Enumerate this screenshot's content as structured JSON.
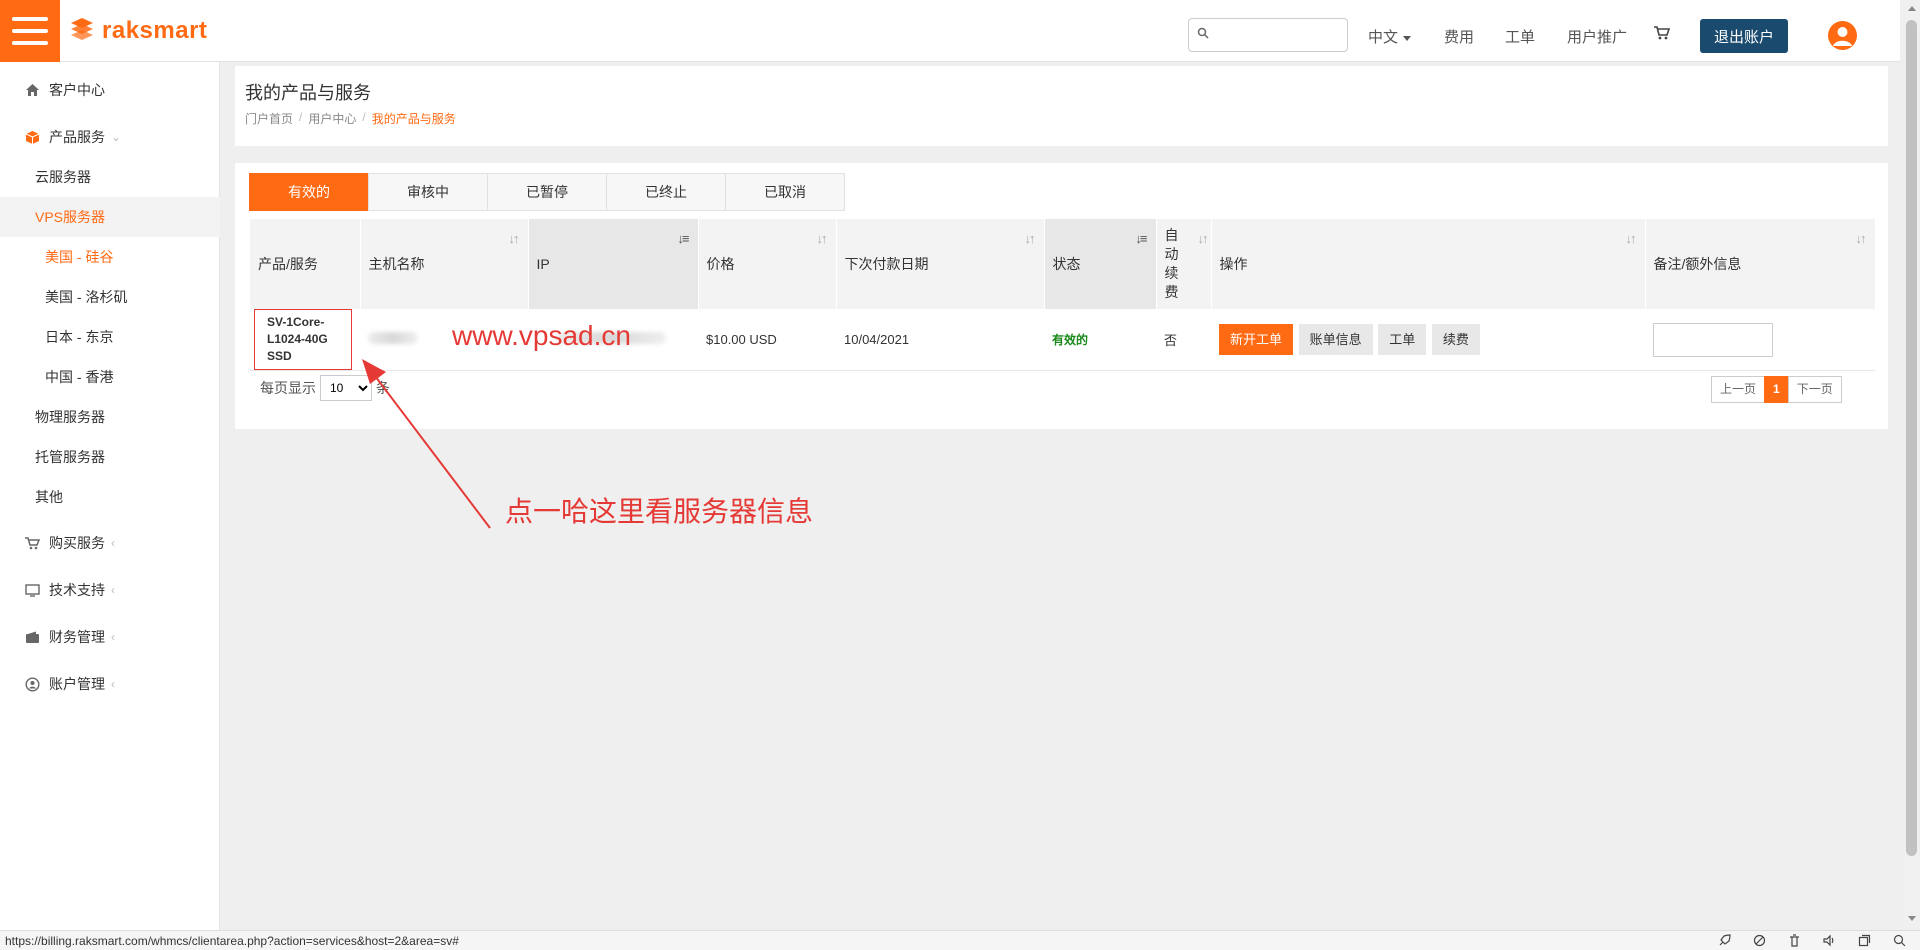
{
  "header": {
    "logo": "raksmart",
    "search_placeholder": "",
    "lang": "中文",
    "nav_fees": "费用",
    "nav_tickets": "工单",
    "nav_affiliate": "用户推广",
    "logout": "退出账户"
  },
  "sidebar": {
    "client_center": "客户中心",
    "products": "产品服务",
    "cloud": "云服务器",
    "vps": "VPS服务器",
    "vps_sub": [
      "美国 - 硅谷",
      "美国 - 洛杉矶",
      "日本 - 东京",
      "中国 - 香港"
    ],
    "physical": "物理服务器",
    "hosting": "托管服务器",
    "other": "其他",
    "buy": "购买服务",
    "support": "技术支持",
    "finance": "财务管理",
    "account": "账户管理"
  },
  "page": {
    "title": "我的产品与服务",
    "breadcrumb": [
      "门户首页",
      "用户中心",
      "我的产品与服务"
    ]
  },
  "tabs": [
    "有效的",
    "审核中",
    "已暂停",
    "已终止",
    "已取消"
  ],
  "table": {
    "headers": {
      "product": "产品/服务",
      "host": "主机名称",
      "ip": "IP",
      "price": "价格",
      "next_due": "下次付款日期",
      "status": "状态",
      "auto_renew": "自动续费",
      "actions": "操作",
      "remark": "备注/额外信息"
    },
    "rows": [
      {
        "product_line1": "SV-1Core-",
        "product_line2": "L1024-40G SSD",
        "price": "$10.00 USD",
        "next_due": "10/04/2021",
        "status": "有效的",
        "auto_renew": "否",
        "btn_new_ticket": "新开工单",
        "btn_billing": "账单信息",
        "btn_ticket": "工单",
        "btn_renew": "续费"
      }
    ]
  },
  "pagination": {
    "per_page_label": "每页显示",
    "per_page_value": "10",
    "per_page_suffix": "条",
    "prev": "上一页",
    "current": "1",
    "next": "下一页"
  },
  "annotations": {
    "watermark": "www.vpsad.cn",
    "note": "点一哈这里看服务器信息"
  },
  "statusbar": {
    "url": "https://billing.raksmart.com/whmcs/clientarea.php?action=services&host=2&area=sv#"
  },
  "colors": {
    "brand": "#ff6a13",
    "logout_bg": "#1a4a6e",
    "annotation": "#e53935",
    "status_ok": "#1a8a1a"
  }
}
